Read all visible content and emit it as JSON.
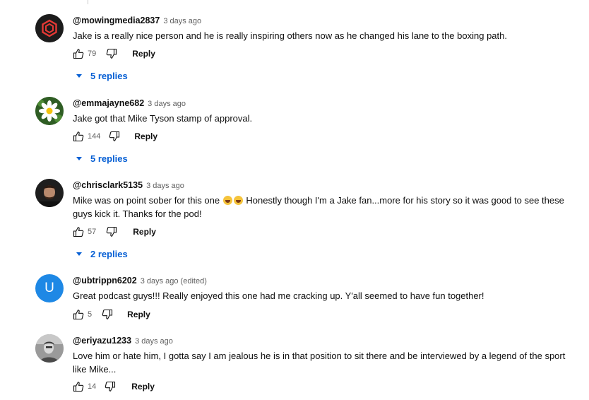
{
  "colors": {
    "link_blue": "#065fd4",
    "meta_gray": "#606060"
  },
  "comments": [
    {
      "handle": "@mowingmedia2837",
      "age": "3 days ago",
      "text": "Jake is a really nice person and he is really inspiring others now as he changed his lane to the boxing path.",
      "likes": "79",
      "reply_label": "Reply",
      "replies_label": "5 replies",
      "avatar_icon": "hexagon-logo"
    },
    {
      "handle": "@emmajayne682",
      "age": "3 days ago",
      "text": "Jake got that Mike Tyson stamp of approval.",
      "likes": "144",
      "reply_label": "Reply",
      "replies_label": "5 replies",
      "avatar_icon": "daisy-flower"
    },
    {
      "handle": "@chrisclark5135",
      "age": "3 days ago",
      "text_part1": "Mike was on point sober for this one",
      "text_part2": "Honestly though I'm a Jake fan...more for his story so it was good to see these guys kick it. Thanks for the pod!",
      "likes": "57",
      "reply_label": "Reply",
      "replies_label": "2 replies",
      "avatar_icon": "person-photo"
    },
    {
      "handle": "@ubtrippn6202",
      "age": "3 days ago (edited)",
      "text": "Great podcast guys!!! Really enjoyed this one had me cracking up. Y'all seemed to have fun together!",
      "likes": "5",
      "reply_label": "Reply",
      "avatar_letter": "U",
      "avatar_color": "#1e88e5"
    },
    {
      "handle": "@eriyazu1233",
      "age": "3 days ago",
      "text": "Love him or hate him, I gotta say I am jealous he is in that position to sit there and be interviewed by a legend of the sport like Mike...",
      "likes": "14",
      "reply_label": "Reply",
      "avatar_icon": "person-photo-gray"
    }
  ]
}
